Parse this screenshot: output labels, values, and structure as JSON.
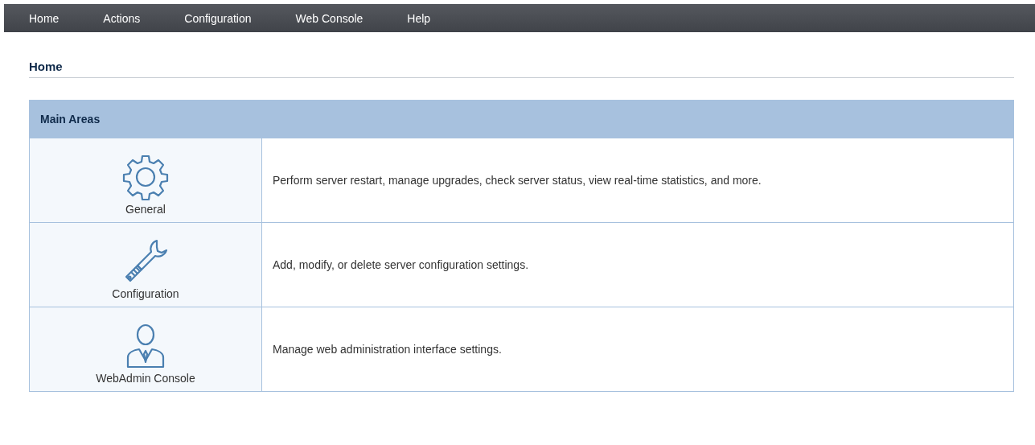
{
  "menu": [
    "Home",
    "Actions",
    "Configuration",
    "Web Console",
    "Help"
  ],
  "page_title": "Home",
  "table": {
    "title": "Main Areas",
    "rows": [
      {
        "name": "General",
        "description": "Perform server restart, manage upgrades, check server status, view real-time statistics, and more."
      },
      {
        "name": "Configuration",
        "description": "Add, modify, or delete server configuration settings."
      },
      {
        "name": "WebAdmin Console",
        "description": "Manage web administration interface settings."
      }
    ]
  }
}
